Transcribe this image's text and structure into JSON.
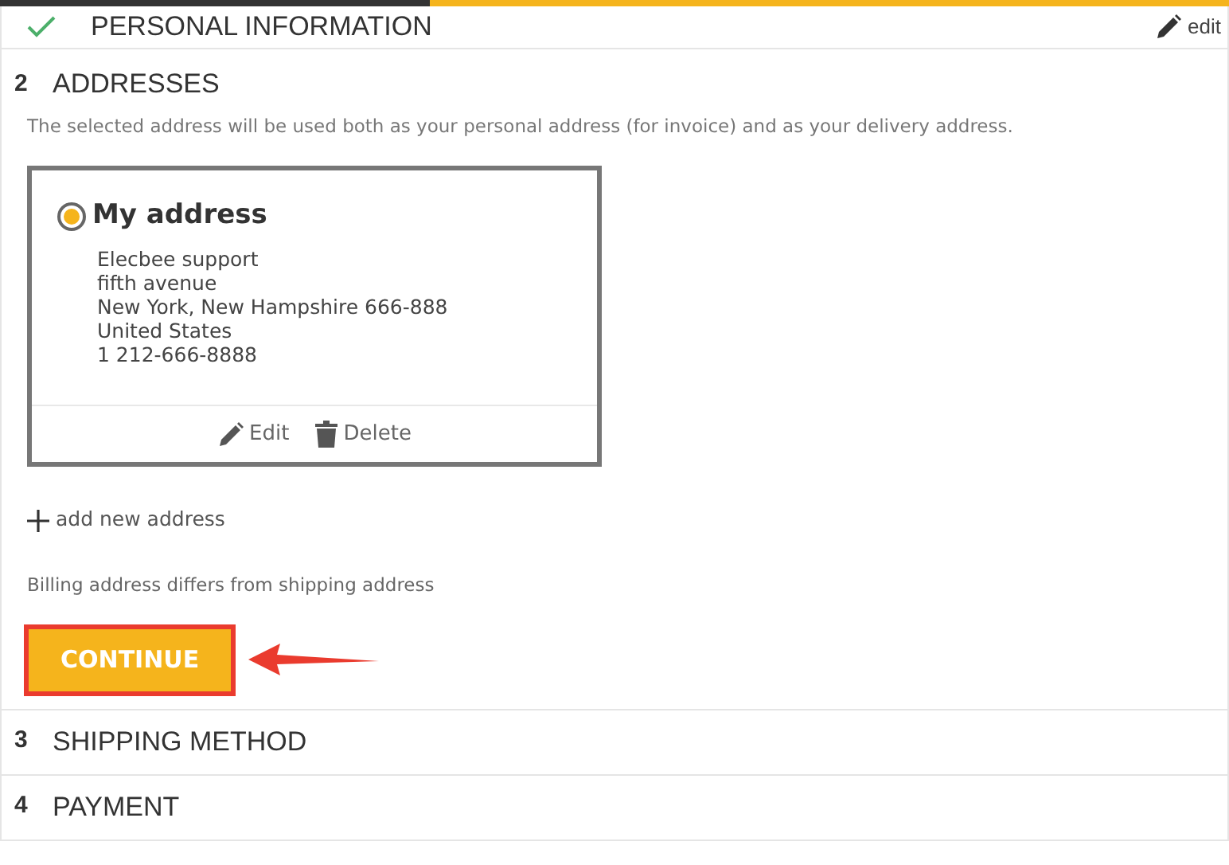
{
  "progress": {
    "level": 0.35
  },
  "steps": [
    {
      "kind": "done",
      "title": "PERSONAL INFORMATION",
      "edit_label": "edit"
    },
    {
      "kind": "current",
      "number": "2",
      "title": "ADDRESSES",
      "description": "The selected address will be used both as your personal address (for invoice) and as your delivery address.",
      "addresses": [
        {
          "title": "My address",
          "selected": true,
          "lines": [
            "Elecbee support",
            "fifth avenue",
            "New York, New Hampshire 666-888",
            "United States",
            "1 212-666-8888"
          ],
          "edit_label": "Edit",
          "delete_label": "Delete"
        }
      ],
      "add_label": "add new address",
      "billing_link": "Billing address differs from shipping address",
      "continue_label": "CONTINUE"
    },
    {
      "kind": "pending",
      "number": "3",
      "title": "SHIPPING METHOD"
    },
    {
      "kind": "pending",
      "number": "4",
      "title": "PAYMENT"
    }
  ]
}
